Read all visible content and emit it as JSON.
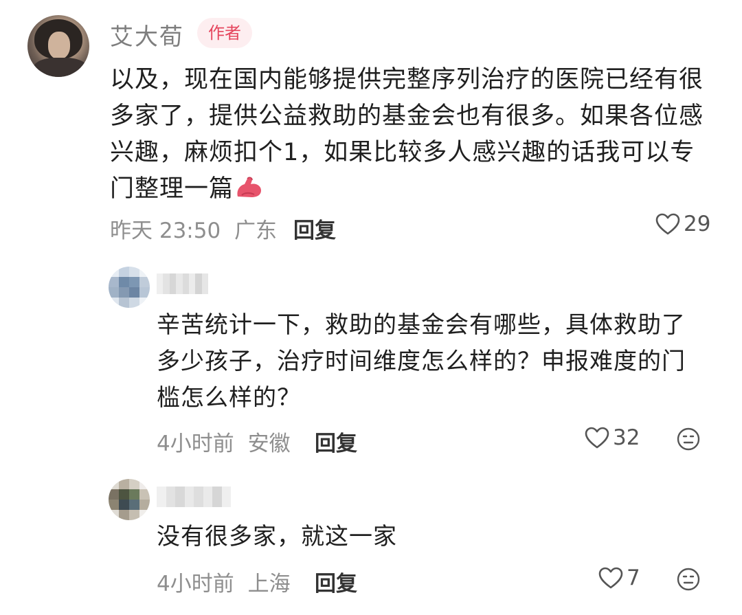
{
  "main_comment": {
    "username": "艾大荀",
    "badge": "作者",
    "text": "以及，现在国内能够提供完整序列治疗的医院已经有很多家了，提供公益救助的基金会也有很多。如果各位感兴趣，麻烦扣个1，如果比较多人感兴趣的话我可以专门整理一篇",
    "emoji": "flexed-biceps-icon",
    "time": "昨天 23:50",
    "location": "广东",
    "reply_label": "回复",
    "likes": "29"
  },
  "replies": [
    {
      "text": "辛苦统计一下，救助的基金会有哪些，具体救助了多少孩子，治疗时间维度怎么样的？申报难度的门槛怎么样的？",
      "time": "4小时前",
      "location": "安徽",
      "reply_label": "回复",
      "likes": "32"
    },
    {
      "text": "没有很多家，就这一家",
      "time": "4小时前",
      "location": "上海",
      "reply_label": "回复",
      "likes": "7"
    }
  ],
  "colors": {
    "badge_bg": "#fdeef0",
    "badge_text": "#e5455d",
    "meta_text": "#8e8e8e"
  }
}
